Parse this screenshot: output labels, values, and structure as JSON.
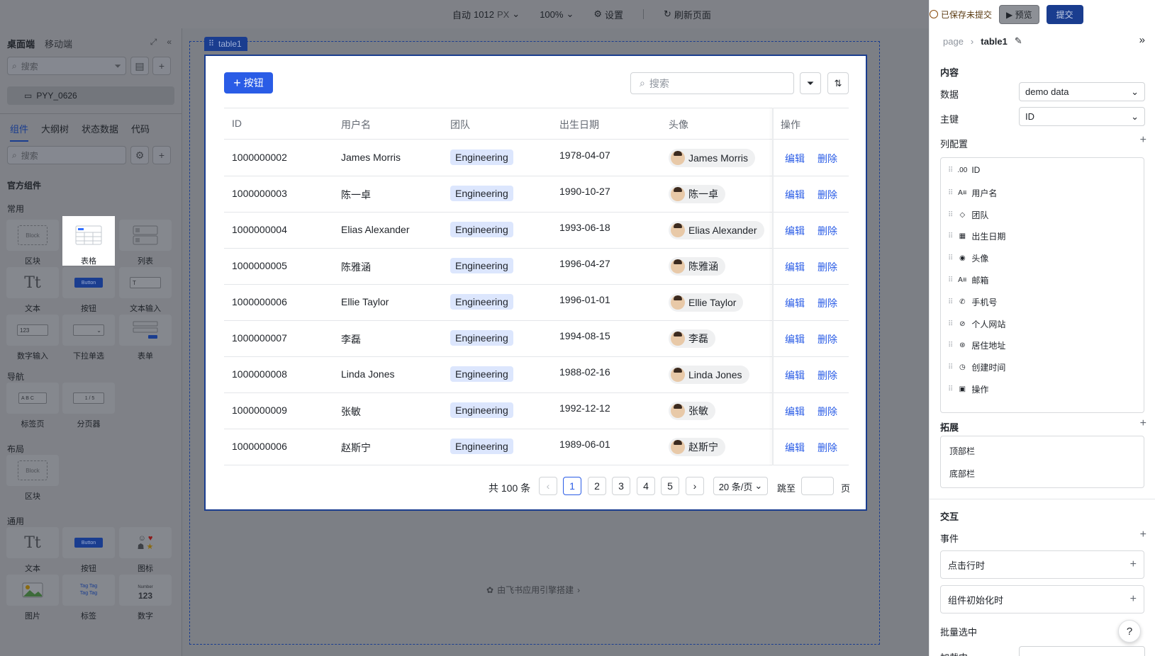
{
  "topbar": {
    "canvas_mode": "自动",
    "canvas_width": "1012",
    "canvas_unit": "PX",
    "zoom": "100%",
    "settings": "设置",
    "refresh": "刷新页面",
    "unsaved": "已保存未提交",
    "preview": "预览",
    "submit": "提交"
  },
  "left": {
    "tabs": [
      "桌面端",
      "移动端"
    ],
    "search_placeholder": "搜索",
    "page_name": "PYY_0626",
    "tabs2": [
      "组件",
      "大纲树",
      "状态数据",
      "代码"
    ],
    "component_search_placeholder": "搜索",
    "official": "官方组件",
    "sections": {
      "common": "常用",
      "nav": "导航",
      "layout": "布局",
      "general": "通用"
    },
    "common_items": [
      "区块",
      "表格",
      "列表",
      "文本",
      "按钮",
      "文本输入",
      "数字输入",
      "下拉单选",
      "表单"
    ],
    "nav_items": [
      "标签页",
      "分页器"
    ],
    "layout_items": [
      "区块"
    ],
    "general_items": [
      "文本",
      "按钮",
      "图标",
      "图片",
      "标签",
      "数字"
    ],
    "thumb_text": {
      "block": "Block",
      "button": "Button",
      "number": "123",
      "number_label": "Number",
      "tab_abc": "A B C",
      "pager": "1 / 5",
      "tag": "Tag"
    }
  },
  "canvas": {
    "tag": "table1",
    "add_button": "按钮",
    "search_placeholder": "搜索",
    "columns": [
      "ID",
      "用户名",
      "团队",
      "出生日期",
      "头像",
      "操作"
    ],
    "rows": [
      {
        "id": "1000000002",
        "name": "James Morris",
        "team": "Engineering",
        "birth": "1978-04-07",
        "avatar": "James Morris"
      },
      {
        "id": "1000000003",
        "name": "陈一卓",
        "team": "Engineering",
        "birth": "1990-10-27",
        "avatar": "陈一卓"
      },
      {
        "id": "1000000004",
        "name": "Elias Alexander",
        "team": "Engineering",
        "birth": "1993-06-18",
        "avatar": "Elias Alexander"
      },
      {
        "id": "1000000005",
        "name": "陈雅涵",
        "team": "Engineering",
        "birth": "1996-04-27",
        "avatar": "陈雅涵"
      },
      {
        "id": "1000000006",
        "name": "Ellie Taylor",
        "team": "Engineering",
        "birth": "1996-01-01",
        "avatar": "Ellie Taylor"
      },
      {
        "id": "1000000007",
        "name": "李磊",
        "team": "Engineering",
        "birth": "1994-08-15",
        "avatar": "李磊"
      },
      {
        "id": "1000000008",
        "name": "Linda Jones",
        "team": "Engineering",
        "birth": "1988-02-16",
        "avatar": "Linda Jones"
      },
      {
        "id": "1000000009",
        "name": "张敏",
        "team": "Engineering",
        "birth": "1992-12-12",
        "avatar": "张敏"
      },
      {
        "id": "1000000006",
        "name": "赵斯宁",
        "team": "Engineering",
        "birth": "1989-06-01",
        "avatar": "赵斯宁"
      }
    ],
    "edit": "编辑",
    "delete": "删除",
    "pager": {
      "total": "共 100 条",
      "pages": [
        "1",
        "2",
        "3",
        "4",
        "5"
      ],
      "current": "1",
      "page_size": "20 条/页",
      "jump": "跳至",
      "page_unit": "页"
    },
    "brand": "由飞书应用引擎搭建"
  },
  "right": {
    "crumb_root": "page",
    "crumb_current": "table1",
    "content": "内容",
    "data_label": "数据",
    "data_value": "demo data",
    "key_label": "主键",
    "key_value": "ID",
    "columns_label": "列配置",
    "columns": [
      {
        "icon": ".00",
        "label": "ID"
      },
      {
        "icon": "A≡",
        "label": "用户名"
      },
      {
        "icon": "◇",
        "label": "团队"
      },
      {
        "icon": "▦",
        "label": "出生日期"
      },
      {
        "icon": "◉",
        "label": "头像"
      },
      {
        "icon": "A≡",
        "label": "邮箱"
      },
      {
        "icon": "✆",
        "label": "手机号"
      },
      {
        "icon": "⊘",
        "label": "个人网站"
      },
      {
        "icon": "⊛",
        "label": "居住地址"
      },
      {
        "icon": "◷",
        "label": "创建时间"
      },
      {
        "icon": "▣",
        "label": "操作"
      }
    ],
    "extend_label": "拓展",
    "extend_items": [
      "顶部栏",
      "底部栏"
    ],
    "interact": "交互",
    "events_label": "事件",
    "events": [
      "点击行时",
      "组件初始化时"
    ],
    "batch": "批量选中",
    "loading": "加载中"
  }
}
